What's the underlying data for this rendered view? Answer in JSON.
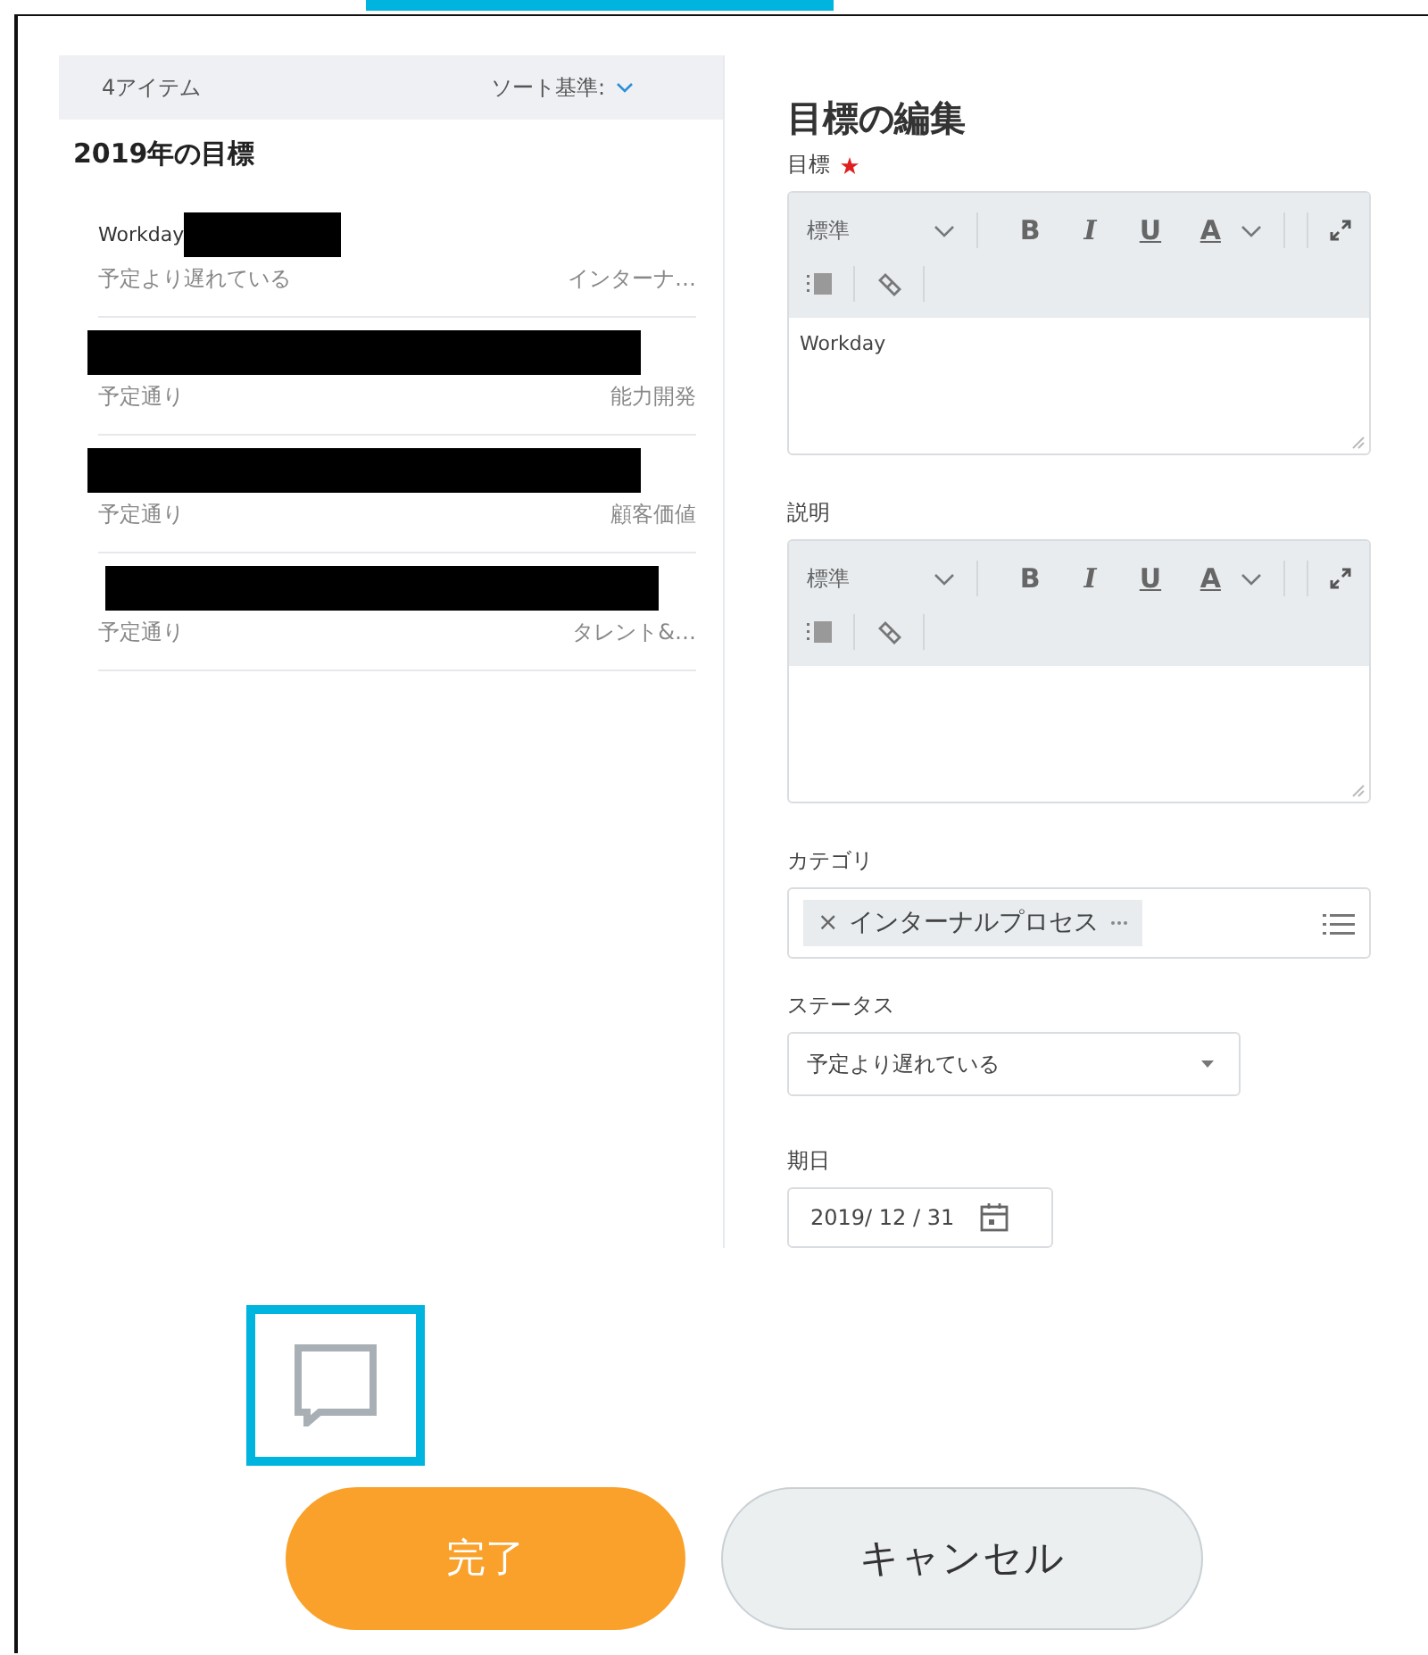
{
  "list_header": {
    "count": "4アイテム",
    "sort_label": "ソート基準:"
  },
  "section_title": "2019年の目標",
  "goals": [
    {
      "title": "Workday",
      "redacted": true,
      "status": "予定より遅れている",
      "category": "インターナ…"
    },
    {
      "redacted": true,
      "status": "予定通り",
      "category": "能力開発"
    },
    {
      "redacted": true,
      "status": "予定通り",
      "category": "顧客価値"
    },
    {
      "redacted": true,
      "status": "予定通り",
      "category": "タレント&…"
    }
  ],
  "editor": {
    "heading": "目標の編集",
    "fields": [
      {
        "kind": "rich_text",
        "label": "目標",
        "required": true,
        "style": "標準",
        "format_buttons": [
          "B",
          "I",
          "U",
          "A"
        ],
        "value": "Workday"
      },
      {
        "kind": "rich_text",
        "label": "説明",
        "required": false,
        "style": "標準",
        "format_buttons": [
          "B",
          "I",
          "U",
          "A"
        ]
      },
      {
        "kind": "tags",
        "label": "カテゴリ",
        "tags": [
          {
            "label": "インターナルプロセス",
            "remove": "×"
          }
        ]
      },
      {
        "kind": "select",
        "label": "ステータス",
        "value": "予定より遅れている"
      },
      {
        "kind": "date",
        "label": "期日",
        "value": "2019/ 12 / 31"
      }
    ]
  },
  "comment_button": {
    "highlighted": true
  },
  "buttons": [
    {
      "kind": "primary",
      "label": "完了"
    },
    {
      "kind": "secondary",
      "label": "キャンセル"
    }
  ]
}
